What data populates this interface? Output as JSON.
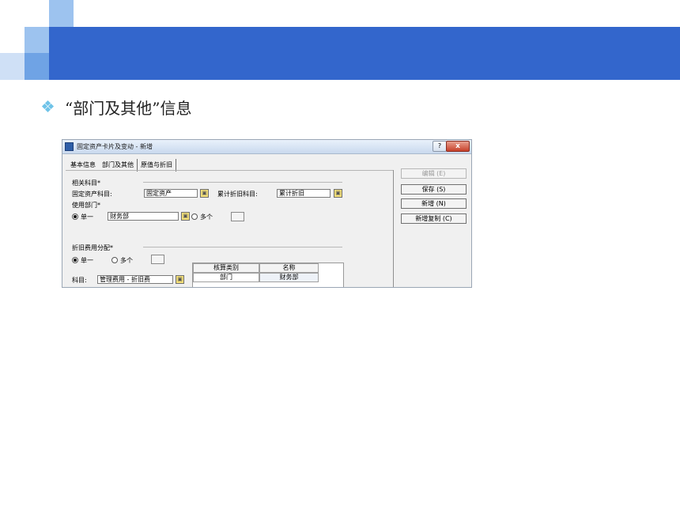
{
  "slide": {
    "heading": "“部门及其他”信息",
    "colors": {
      "band": "#3366cc",
      "accent_light": "#9dc3ef",
      "accent_mid": "#6fa3e5",
      "bullet": "#6fc3e8"
    }
  },
  "dialog": {
    "title": "固定资产卡片及变动 - 新增",
    "help_label": "?",
    "close_label": "x",
    "tabs": [
      "基本信息",
      "部门及其他",
      "原值与折旧"
    ],
    "active_tab": "部门及其他",
    "related_accounts": {
      "group_label": "相关科目",
      "fixed_asset_label": "固定资产科目:",
      "fixed_asset_value": "固定资产",
      "accum_depr_label": "累计折旧科目:",
      "accum_depr_value": "累计折旧"
    },
    "use_dept": {
      "group_label": "使用部门",
      "single_label": "单一",
      "single_value": "财务部",
      "multi_label": "多个",
      "selected": "单一"
    },
    "depr_alloc": {
      "group_label": "折旧费用分配",
      "single_label": "单一",
      "multi_label": "多个",
      "selected": "单一",
      "account_label": "科目:",
      "account_value": "管理费用 - 折旧费",
      "grid_headers": [
        "核算类别",
        "名称"
      ],
      "grid_rows": [
        [
          "部门",
          "财务部"
        ]
      ]
    },
    "buttons": {
      "edit": "编辑 (E)",
      "save": "保存 (S)",
      "add": "新增 (N)",
      "add_copy": "新增复制 (C)"
    },
    "required_mark": "*"
  }
}
